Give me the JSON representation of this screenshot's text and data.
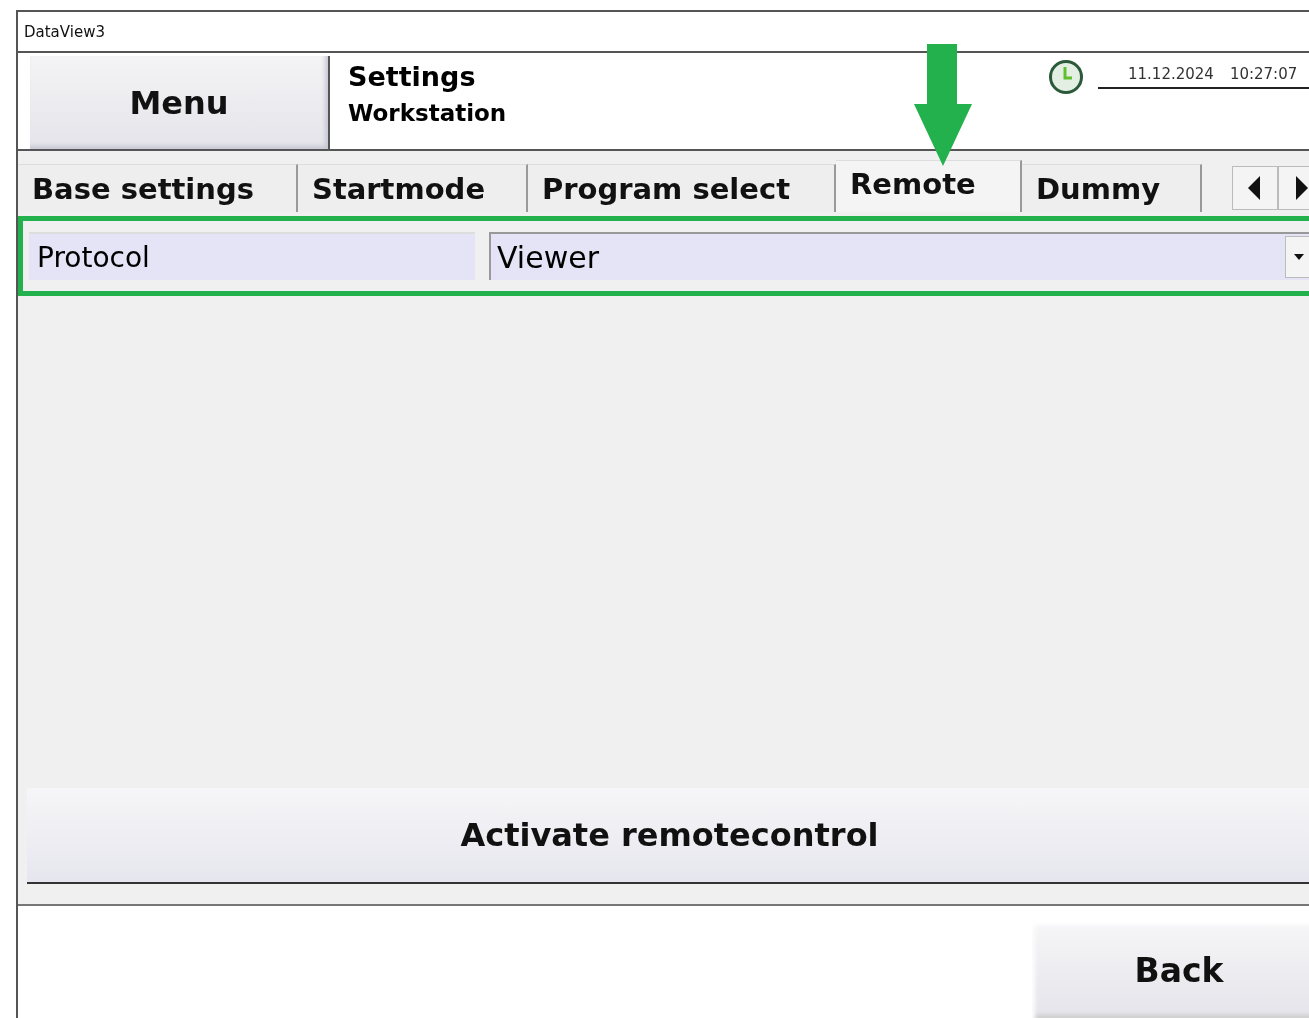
{
  "window": {
    "title": "DataView3"
  },
  "header": {
    "menu_button": "Menu",
    "title": "Settings",
    "subtitle": "Workstation",
    "date": "11.12.2024",
    "time": "10:27:07"
  },
  "tabs": [
    {
      "label": "Base settings",
      "selected": false,
      "highlighted": false
    },
    {
      "label": "Startmode",
      "selected": false,
      "highlighted": false
    },
    {
      "label": "Program select",
      "selected": false,
      "highlighted": false
    },
    {
      "label": "Remote",
      "selected": true,
      "highlighted": true
    },
    {
      "label": "Dummy",
      "selected": false,
      "highlighted": false
    }
  ],
  "settings": [
    {
      "label": "Protocol",
      "value": "Viewer",
      "highlighted": true
    }
  ],
  "action_button": "Activate remotecontrol",
  "footer": {
    "back_button": "Back"
  }
}
